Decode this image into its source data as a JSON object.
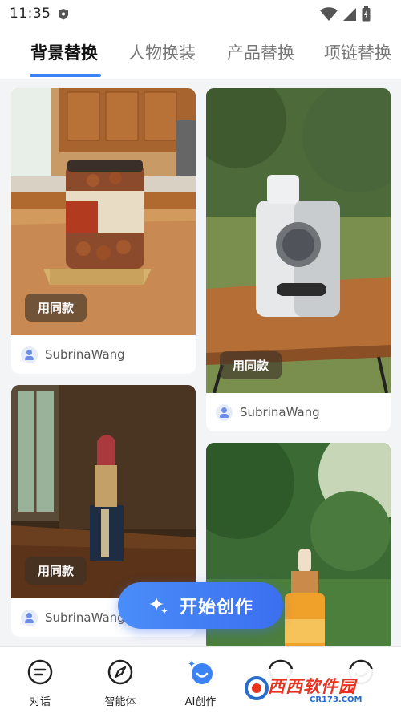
{
  "status": {
    "time": "11:35"
  },
  "tabs": [
    {
      "label": "背景替换",
      "active": true
    },
    {
      "label": "人物换装",
      "active": false
    },
    {
      "label": "产品替换",
      "active": false
    },
    {
      "label": "项链替换",
      "active": false
    }
  ],
  "cards": [
    {
      "same_label": "用同款",
      "user": "SubrinaWang",
      "subject": "walnut-jar-kitchen"
    },
    {
      "same_label": "用同款",
      "user": "SubrinaWang",
      "subject": "white-device-park-table"
    },
    {
      "same_label": "用同款",
      "user": "SubrinaWang",
      "subject": "lipstick-window-table"
    },
    {
      "subject": "serum-bottle-forest"
    }
  ],
  "fab": {
    "label": "开始创作",
    "icon": "sparkle-icon"
  },
  "bottom_nav": [
    {
      "label": "对话",
      "icon": "chat-icon"
    },
    {
      "label": "智能体",
      "icon": "compass-icon"
    },
    {
      "label": "AI创作",
      "icon": "ai-create-icon",
      "active": true
    },
    {
      "label": "",
      "icon": "message-icon"
    },
    {
      "label": "",
      "icon": "profile-icon"
    }
  ],
  "watermark": {
    "text": "西西软件园",
    "sub": "CR173.COM"
  },
  "colors": {
    "accent": "#3b82f6",
    "background": "#f3f4f6"
  }
}
